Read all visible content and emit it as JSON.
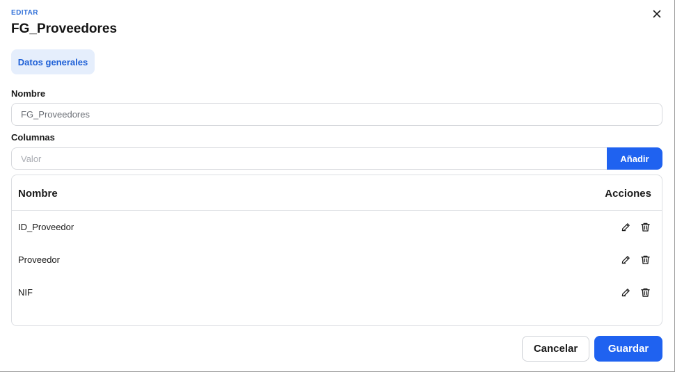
{
  "header": {
    "eyebrow": "EDITAR",
    "title": "FG_Proveedores",
    "close_icon": "close-icon"
  },
  "tabs": [
    {
      "label": "Datos generales",
      "active": true
    }
  ],
  "form": {
    "nombre_label": "Nombre",
    "nombre_value": "FG_Proveedores",
    "columnas_label": "Columnas",
    "valor_placeholder": "Valor",
    "add_button": "Añadir"
  },
  "table": {
    "columns": [
      "Nombre",
      "Acciones"
    ],
    "rows": [
      {
        "name": "ID_Proveedor",
        "actions": [
          "edit-icon",
          "trash-icon"
        ]
      },
      {
        "name": "Proveedor",
        "actions": [
          "edit-icon",
          "trash-icon"
        ]
      },
      {
        "name": "NIF",
        "actions": [
          "edit-icon",
          "trash-icon"
        ]
      }
    ]
  },
  "footer": {
    "cancel_label": "Cancelar",
    "save_label": "Guardar"
  },
  "colors": {
    "accent": "#1f62f0",
    "tab_bg": "#e5eefc",
    "eyebrow": "#2f6fd8"
  }
}
